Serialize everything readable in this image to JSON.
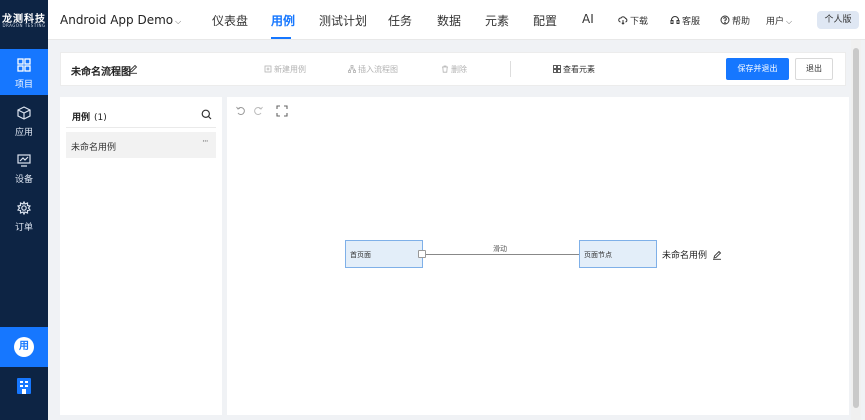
{
  "brand": {
    "name_cn": "龙测科技",
    "name_en": "DRAGON TESTING"
  },
  "rail": {
    "items": [
      {
        "label": "项目",
        "icon": "grid-icon",
        "active": true
      },
      {
        "label": "应用",
        "icon": "cube-icon",
        "active": false
      },
      {
        "label": "设备",
        "icon": "monitor-icon",
        "active": false
      },
      {
        "label": "订单",
        "icon": "gear-icon",
        "active": false
      }
    ],
    "avatar": "用",
    "bottom_icon": "building-icon"
  },
  "header": {
    "app_name": "Android App Demo",
    "tabs": [
      "仪表盘",
      "用例",
      "测试计划",
      "任务",
      "数据",
      "元素",
      "配置",
      "AI"
    ],
    "active_tab": "用例",
    "actions": {
      "download": "下载",
      "service": "客服",
      "help": "帮助"
    },
    "user": "用户",
    "edition": "个人版"
  },
  "toolbar": {
    "flow_title": "未命名流程图",
    "new_case": "新建用例",
    "insert_flow": "插入流程图",
    "delete": "删除",
    "view_elements": "查看元素",
    "save_exit": "保存并退出",
    "exit": "退出"
  },
  "case_panel": {
    "title": "用例",
    "count": "(1)",
    "items": [
      {
        "name": "未命名用例",
        "more": "···"
      }
    ]
  },
  "canvas": {
    "nodes": {
      "home": "首页面",
      "page_node": "页面节点"
    },
    "edge_label": "滑动",
    "case_label": "未命名用例"
  },
  "colors": {
    "accent": "#1677ff",
    "rail_bg": "#0d2444",
    "node_fill": "#e3eef9",
    "node_border": "#7fb0e8"
  }
}
